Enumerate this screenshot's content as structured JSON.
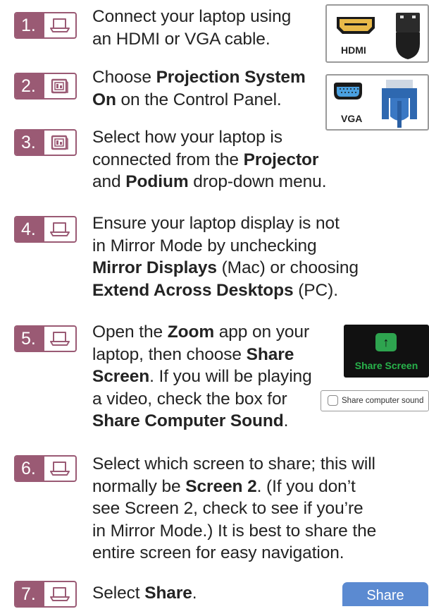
{
  "steps": [
    {
      "number": "1.",
      "icon": "laptop-icon",
      "lines": [
        [
          {
            "t": "Connect your laptop using"
          }
        ],
        [
          {
            "t": "an HDMI or VGA cable."
          }
        ]
      ]
    },
    {
      "number": "2.",
      "icon": "control-panel-icon",
      "lines": [
        [
          {
            "t": "Choose "
          },
          {
            "t": "Projection System",
            "b": true
          }
        ],
        [
          {
            "t": "On",
            "b": true
          },
          {
            "t": " on the Control Panel."
          }
        ]
      ]
    },
    {
      "number": "3.",
      "icon": "control-panel-icon",
      "lines": [
        [
          {
            "t": "Select how your laptop is"
          }
        ],
        [
          {
            "t": "connected from the "
          },
          {
            "t": "Projector",
            "b": true
          }
        ],
        [
          {
            "t": "and "
          },
          {
            "t": "Podium",
            "b": true
          },
          {
            "t": " drop-down menu."
          }
        ]
      ]
    },
    {
      "number": "4.",
      "icon": "laptop-icon",
      "lines": [
        [
          {
            "t": "Ensure your laptop display is not"
          }
        ],
        [
          {
            "t": "in Mirror Mode by unchecking"
          }
        ],
        [
          {
            "t": "Mirror Displays",
            "b": true
          },
          {
            "t": " (Mac) or choosing"
          }
        ],
        [
          {
            "t": "Extend Across Desktops",
            "b": true
          },
          {
            "t": " (PC)."
          }
        ]
      ]
    },
    {
      "number": "5.",
      "icon": "laptop-icon",
      "lines": [
        [
          {
            "t": "Open the "
          },
          {
            "t": "Zoom",
            "b": true
          },
          {
            "t": " app on your"
          }
        ],
        [
          {
            "t": "laptop, then choose "
          },
          {
            "t": "Share",
            "b": true
          }
        ],
        [
          {
            "t": "Screen",
            "b": true
          },
          {
            "t": ". If you will be playing"
          }
        ],
        [
          {
            "t": "a video, check the box for"
          }
        ],
        [
          {
            "t": "Share Computer Sound",
            "b": true
          },
          {
            "t": "."
          }
        ]
      ]
    },
    {
      "number": "6.",
      "icon": "laptop-icon",
      "lines": [
        [
          {
            "t": "Select which screen to share; this will"
          }
        ],
        [
          {
            "t": "normally be "
          },
          {
            "t": "Screen 2",
            "b": true
          },
          {
            "t": ". (If you don’t"
          }
        ],
        [
          {
            "t": "see Screen 2, check to see if you’re"
          }
        ],
        [
          {
            "t": "in Mirror Mode.) It is best to share the"
          }
        ],
        [
          {
            "t": "entire screen for easy navigation."
          }
        ]
      ]
    },
    {
      "number": "7.",
      "icon": "laptop-icon",
      "lines": [
        [
          {
            "t": "Select "
          },
          {
            "t": "Share",
            "b": true
          },
          {
            "t": "."
          }
        ]
      ]
    }
  ],
  "thumbs": {
    "hdmi_label": "HDMI",
    "vga_label": "VGA",
    "zoom_label": "Share Screen",
    "sound_label": "Share computer sound",
    "share_label": "Share"
  },
  "colors": {
    "accent": "#9a5a74",
    "share_blue": "#5b8ad1",
    "zoom_green": "#2ea44f"
  }
}
